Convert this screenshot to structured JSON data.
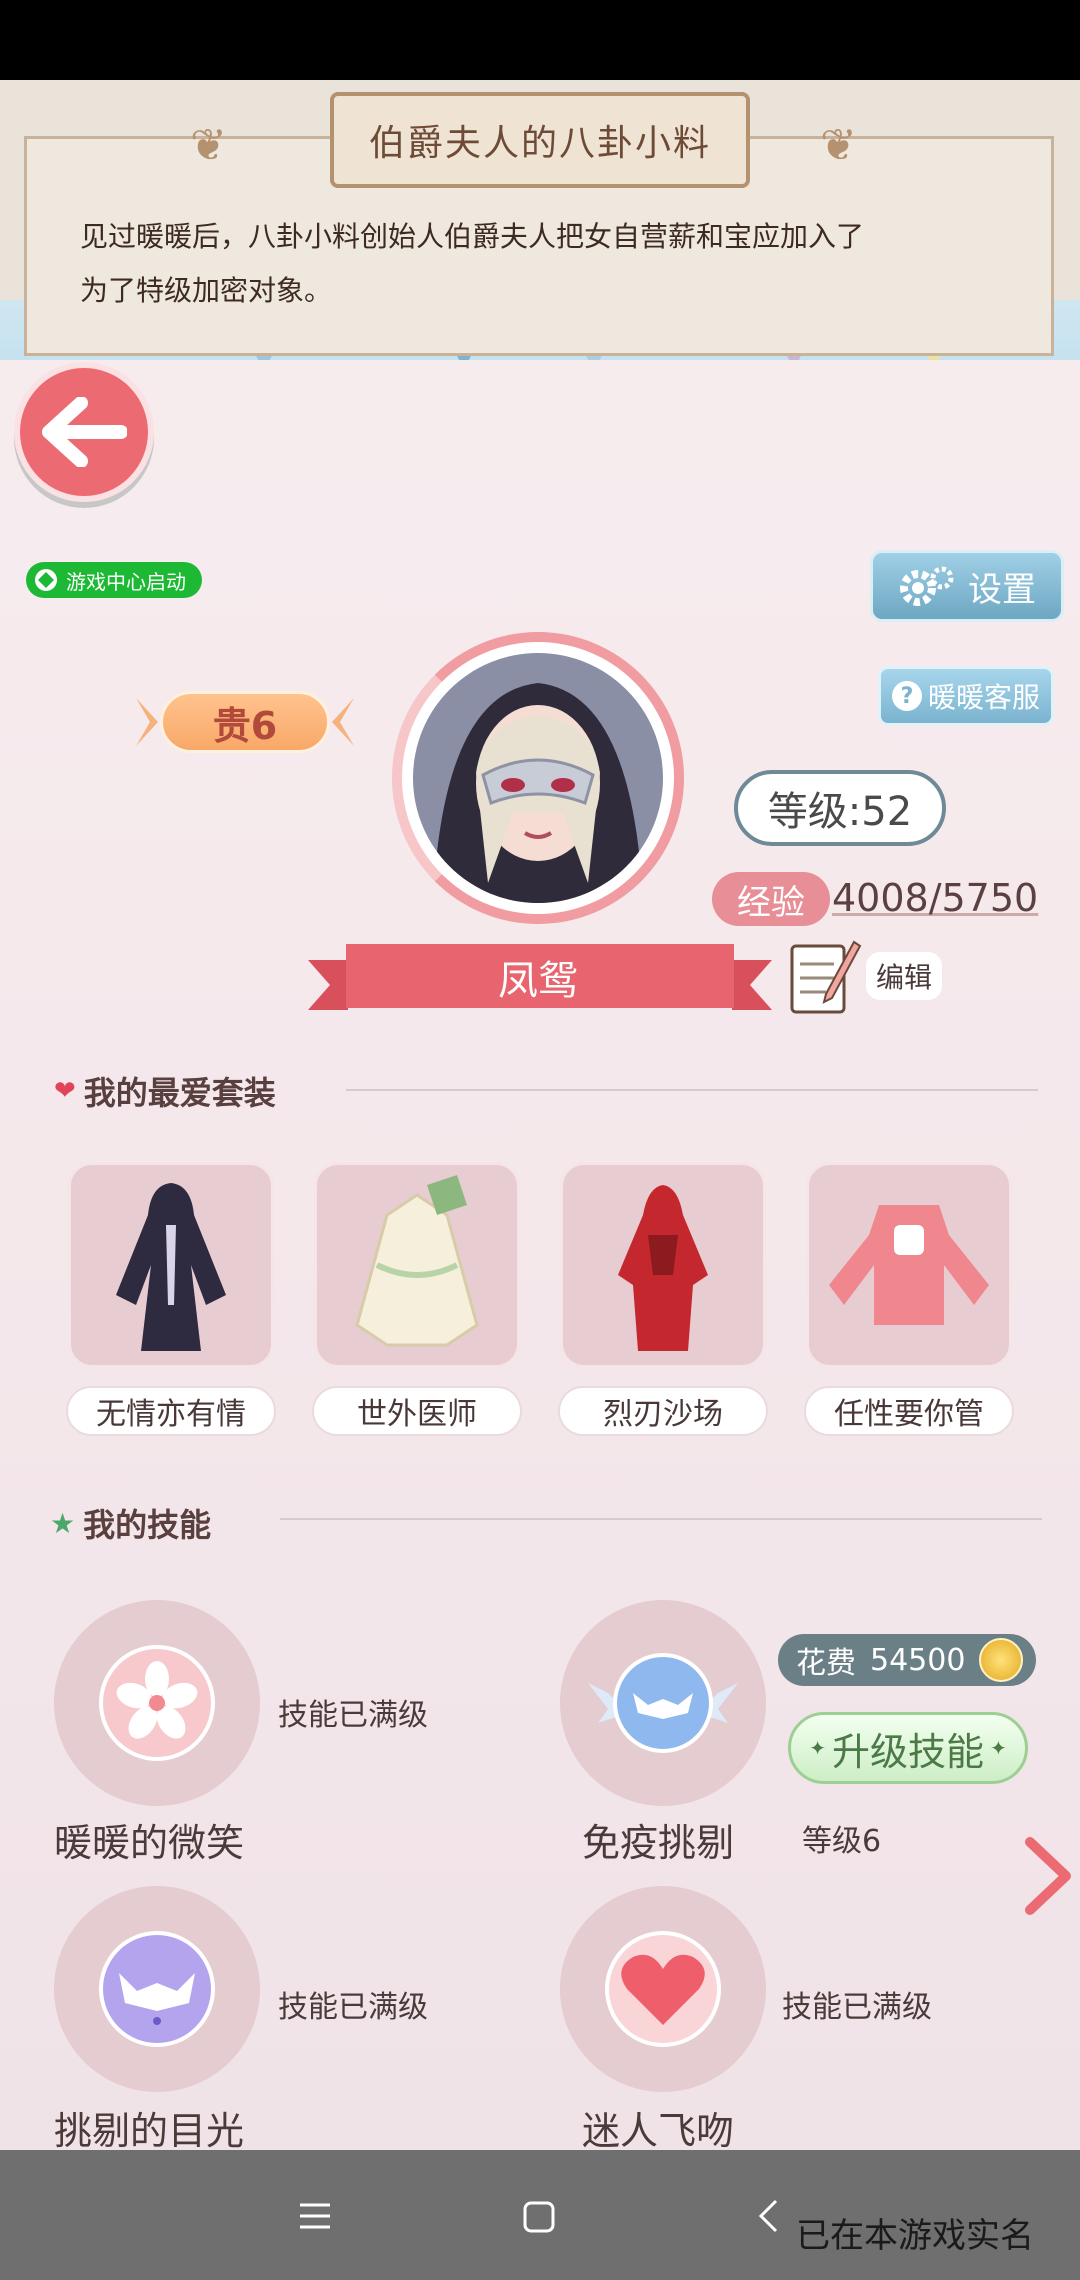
{
  "banner": {
    "title": "伯爵夫人的八卦小料",
    "text_line1": "见过暖暖后，八卦小料创始人伯爵夫人把女自营薪和宝应加入了",
    "text_line2": "为了特级加密对象。"
  },
  "header": {
    "game_center_label": "游戏中心启动",
    "settings_label": "设置",
    "support_label": "暖暖客服",
    "vip_label": "贵6"
  },
  "profile": {
    "level_label": "等级:52",
    "exp_label": "经验",
    "exp_value": "4008/5750",
    "name": "凤鸳",
    "edit_label": "编辑"
  },
  "favorites": {
    "title": "我的最爱套装",
    "items": [
      {
        "label": "无情亦有情"
      },
      {
        "label": "世外医师"
      },
      {
        "label": "烈刃沙场"
      },
      {
        "label": "任性要你管"
      }
    ]
  },
  "skills": {
    "title": "我的技能",
    "items": [
      {
        "name": "暖暖的微笑",
        "status": "技能已满级"
      },
      {
        "name": "免疫挑剔",
        "status": "等级6"
      },
      {
        "name": "挑剔的目光",
        "status": "技能已满级"
      },
      {
        "name": "迷人飞吻",
        "status": "技能已满级"
      }
    ],
    "cost_label": "花费",
    "cost_value": "54500",
    "upgrade_label": "升级技能"
  },
  "footer": {
    "realname_note": "已在本游戏实名"
  },
  "colors": {
    "accent_pink": "#ec6b72",
    "ribbon_pink": "#e8646f",
    "green_badge": "#1db934",
    "blue_button": "#6ea7c2"
  }
}
